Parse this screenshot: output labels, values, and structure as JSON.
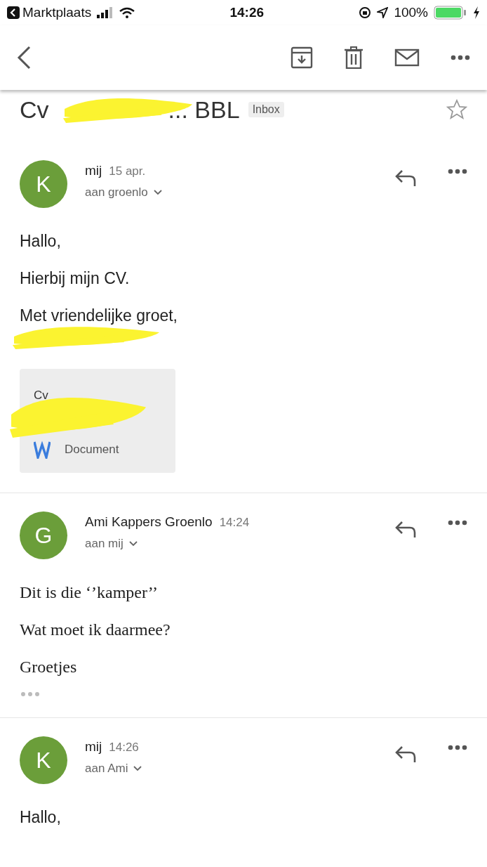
{
  "status_bar": {
    "app_back": "Marktplaats",
    "time": "14:26",
    "battery": "100%"
  },
  "subject": {
    "start": "Cv",
    "end": "... BBL",
    "redacted": true,
    "label": "Inbox",
    "starred": false
  },
  "messages": [
    {
      "avatar": "K",
      "sender": "mij",
      "date": "15 apr.",
      "recipient": "aan groenlo",
      "kind": "sans",
      "paragraphs": [
        "Hallo,",
        "Hierbij mijn CV.",
        "Met vriendelijke groet,"
      ],
      "signature_redacted": true,
      "attachment": {
        "name": "Cv",
        "redacted": true,
        "type": "Document"
      }
    },
    {
      "avatar": "G",
      "sender": "Ami Kappers Groenlo",
      "date": "14:24",
      "recipient": "aan mij",
      "kind": "serif",
      "paragraphs": [
        "Dit is die ‘’kamper’’",
        "Wat moet ik daarmee?",
        "Groetjes"
      ],
      "collapsed_quote": true
    },
    {
      "avatar": "K",
      "sender": "mij",
      "date": "14:26",
      "recipient": "aan Ami",
      "kind": "sans",
      "paragraphs": [
        "Hallo,"
      ]
    }
  ]
}
